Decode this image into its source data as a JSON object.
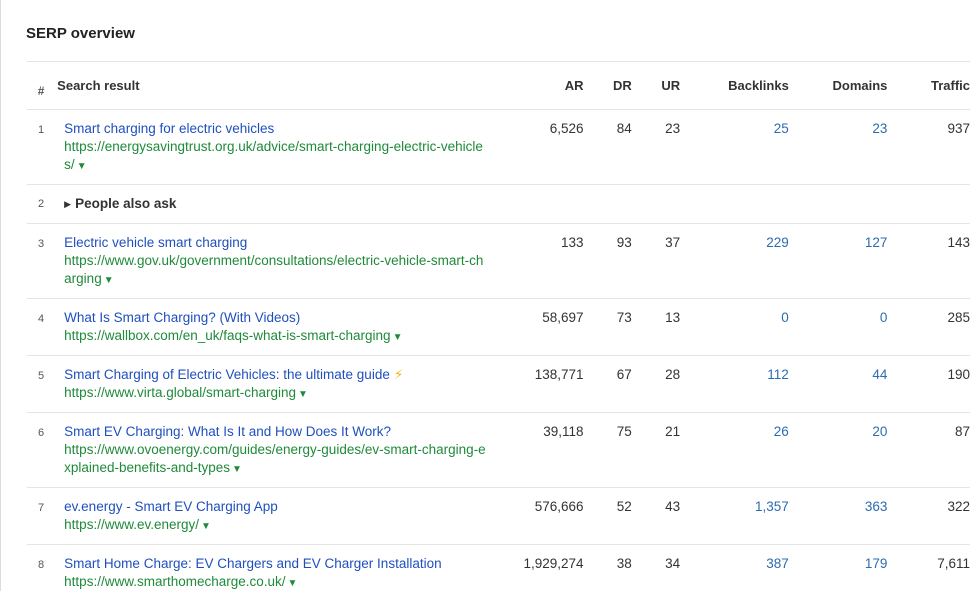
{
  "panel": {
    "title": "SERP overview"
  },
  "columns": {
    "num": "#",
    "result": "Search result",
    "ar": "AR",
    "dr": "DR",
    "ur": "UR",
    "backlinks": "Backlinks",
    "domains": "Domains",
    "traffic": "Traffic"
  },
  "rows": [
    {
      "num": "1",
      "title": "Smart charging for electric vehicles",
      "url": "https://energysavingtrust.org.uk/advice/smart-charging-electric-vehicles/",
      "ar": "6,526",
      "dr": "84",
      "ur": "23",
      "backlinks": "25",
      "domains": "23",
      "traffic": "937"
    },
    {
      "num": "2",
      "paa": "People also ask"
    },
    {
      "num": "3",
      "title": "Electric vehicle smart charging",
      "url": "https://www.gov.uk/government/consultations/electric-vehicle-smart-charging",
      "ar": "133",
      "dr": "93",
      "ur": "37",
      "backlinks": "229",
      "domains": "127",
      "traffic": "143"
    },
    {
      "num": "4",
      "title": "What Is Smart Charging? (With Videos)",
      "url": "https://wallbox.com/en_uk/faqs-what-is-smart-charging",
      "ar": "58,697",
      "dr": "73",
      "ur": "13",
      "backlinks": "0",
      "domains": "0",
      "traffic": "285"
    },
    {
      "num": "5",
      "title": "Smart Charging of Electric Vehicles: the ultimate guide",
      "url": "https://www.virta.global/smart-charging",
      "ar": "138,771",
      "dr": "67",
      "ur": "28",
      "backlinks": "112",
      "domains": "44",
      "traffic": "190"
    },
    {
      "num": "6",
      "title": "Smart EV Charging: What Is It and How Does It Work?",
      "url": "https://www.ovoenergy.com/guides/energy-guides/ev-smart-charging-explained-benefits-and-types",
      "ar": "39,118",
      "dr": "75",
      "ur": "21",
      "backlinks": "26",
      "domains": "20",
      "traffic": "87"
    },
    {
      "num": "7",
      "title": "ev.energy - Smart EV Charging App",
      "url": "https://www.ev.energy/",
      "ar": "576,666",
      "dr": "52",
      "ur": "43",
      "backlinks": "1,357",
      "domains": "363",
      "traffic": "322"
    },
    {
      "num": "8",
      "title": "Smart Home Charge: EV Chargers and EV Charger Installation",
      "url": "https://www.smarthomecharge.co.uk/",
      "ar": "1,929,274",
      "dr": "38",
      "ur": "34",
      "backlinks": "387",
      "domains": "179",
      "traffic": "7,611"
    }
  ],
  "icons": {
    "caret": "caret-down-icon",
    "triangle": "triangle-right-icon",
    "bolt": "lightning-bolt-icon"
  },
  "colors": {
    "link": "#1f4fbf",
    "url": "#1f8a3a",
    "metric_link": "#2b6cb0",
    "bolt": "#f5b914"
  }
}
